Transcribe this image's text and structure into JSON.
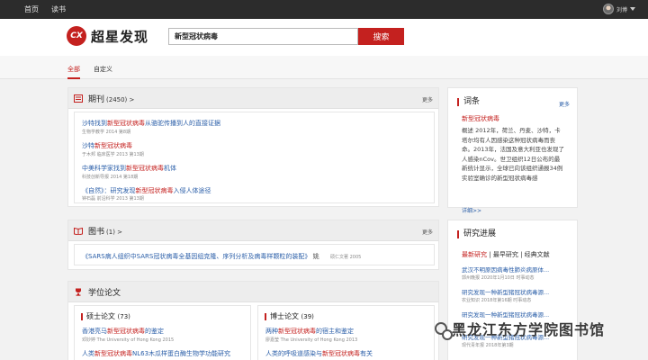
{
  "topbar": {
    "nav": [
      "首页",
      "读书"
    ],
    "user_name": "刘博"
  },
  "header": {
    "logo_mark": "CX",
    "logo_text": "超星发现",
    "search_value": "新型冠状病毒",
    "search_button": "搜索"
  },
  "tabs": [
    "全部",
    "自定义"
  ],
  "journals": {
    "title": "期刊",
    "count": "(2450) >",
    "more": "更多",
    "items": [
      {
        "pre": "沙特找到",
        "hl": "新型冠状病毒",
        "post": "从骆驼传播到人的直接证据",
        "meta": "生物学教学   2014   第8期"
      },
      {
        "pre": "沙特",
        "hl": "新型冠状病毒",
        "post": "",
        "meta": "于木邦   临床医学   2013   第13期"
      },
      {
        "pre": "中美科学家找到",
        "hl": "新型冠状病毒",
        "post": "机体",
        "meta": "科技创新导报   2014   第18期"
      },
      {
        "pre": "《自然》：研究发现",
        "hl": "新型冠状病毒",
        "post": "入侵人体途径",
        "meta": "钟石磊   前沿科学   2013   第13期"
      }
    ]
  },
  "books": {
    "title": "图书",
    "count": "(1) >",
    "more": "更多",
    "items": [
      {
        "pre": "《SARS病人组织中SARS冠状病毒全基因组克隆、序列分析及病毒样颗粒的装配》",
        "post": "  姚",
        "meta": "硕仁文著 2005"
      }
    ]
  },
  "theses": {
    "title": "学位论文",
    "master": {
      "title": "硕士论文",
      "count": "(73)",
      "items": [
        {
          "pre": "香港亮马",
          "hl": "新型冠状病毒",
          "post": "的鉴定",
          "meta": "邓妙婷  The University of Hong Kong 2015"
        },
        {
          "pre": "人类",
          "hl": "新型冠状病毒",
          "post": "NL63木瓜样蛋白酶生物学功能研究",
          "meta": ""
        }
      ]
    },
    "phd": {
      "title": "博士论文",
      "count": "(39)",
      "items": [
        {
          "pre": "两种",
          "hl": "新型冠状病毒",
          "post": "的宿主和鉴定",
          "meta": "廖嘉莹  The University of Hong Kong 2013"
        },
        {
          "pre": "人类的呼吸道感染与",
          "hl": "新型冠状病毒",
          "post": "有关",
          "meta": ""
        }
      ]
    }
  },
  "glossary": {
    "title": "词条",
    "more": "更多",
    "term": "新型冠状病毒",
    "description": "概述          2012年，荷兰、丹麦、沙特，卡塔尔均有人因感染这种冠状病毒而丧命。2013年，法国及意大利亚也发现了人感染nCov。世卫组织12日公布的最新统计显示，全球已向该组织通报34例实验室确诊的新型冠状病毒感",
    "detail": "详细>>"
  },
  "research": {
    "title": "研究进展",
    "subtabs": [
      "最新研究",
      "最早研究",
      "经典文献"
    ],
    "items": [
      {
        "title": "武汉不明原因病毒性肺炎病原体...",
        "meta": "郭州晚报 2020年1月10日   时事动态"
      },
      {
        "title": "研究发现一种新型猪冠状病毒源...",
        "meta": "农业知识 2018年第16期   时事动态"
      },
      {
        "title": "研究发现一种新型猪冠状病毒源...",
        "meta": ""
      },
      {
        "title": "研究发现一种新型猪冠状病毒源...",
        "meta": "现代青年报 2018年第3期"
      }
    ]
  },
  "watermark": "黑龙江东方学院图书馆"
}
